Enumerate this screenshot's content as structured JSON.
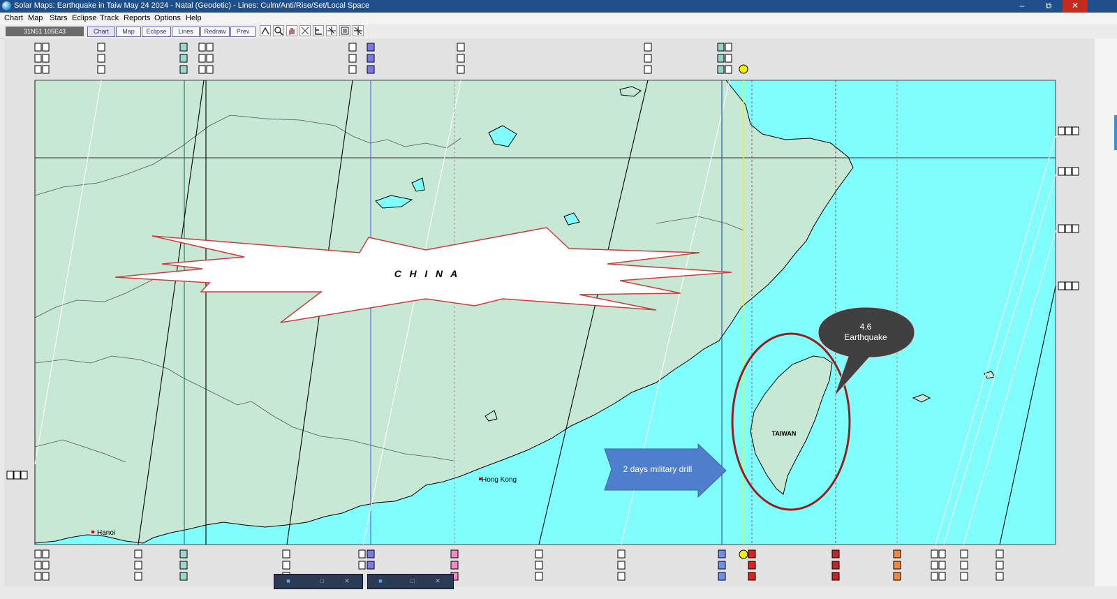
{
  "window": {
    "title": "Solar Maps: Earthquake in Taiw May 24 2024 - Natal (Geodetic) - Lines: Culm/Anti/Rise/Set/Local Space",
    "minimize": "–",
    "maximize": "⧉",
    "close": "✕"
  },
  "menu": [
    "Chart",
    "Map",
    "Stars",
    "Eclipse",
    "Track",
    "Reports",
    "Options",
    "Help"
  ],
  "toolbar": {
    "coords": "31N51 105E43",
    "buttons": [
      "Chart",
      "Map",
      "Eclipse",
      "Lines",
      "Redraw",
      "Prev"
    ],
    "icons": [
      "crosshair-icon",
      "zoom-icon",
      "hand-icon",
      "select-icon",
      "ruler-icon",
      "grid-icon",
      "legend-icon",
      "cross-icon"
    ]
  },
  "map": {
    "land_color": "#c6e8d4",
    "sea_color": "#80fefe",
    "labels": {
      "china": "C   H   I   N   A",
      "taiwan": "TAIWAN",
      "hong_kong": "Hong Kong",
      "hanoi": "Hanoi"
    },
    "annotations": {
      "speech_line1": "4.6",
      "speech_line2": "Earthquake",
      "arrow_text": "2 days military drill"
    },
    "colors": {
      "burst_stroke": "#d23b3b",
      "ellipse_stroke": "#9c1c1c",
      "speech_fill": "#404040",
      "arrow_fill": "#4f7fcc"
    }
  },
  "taskbar": {
    "thumbs": [
      "□",
      "✕"
    ]
  }
}
